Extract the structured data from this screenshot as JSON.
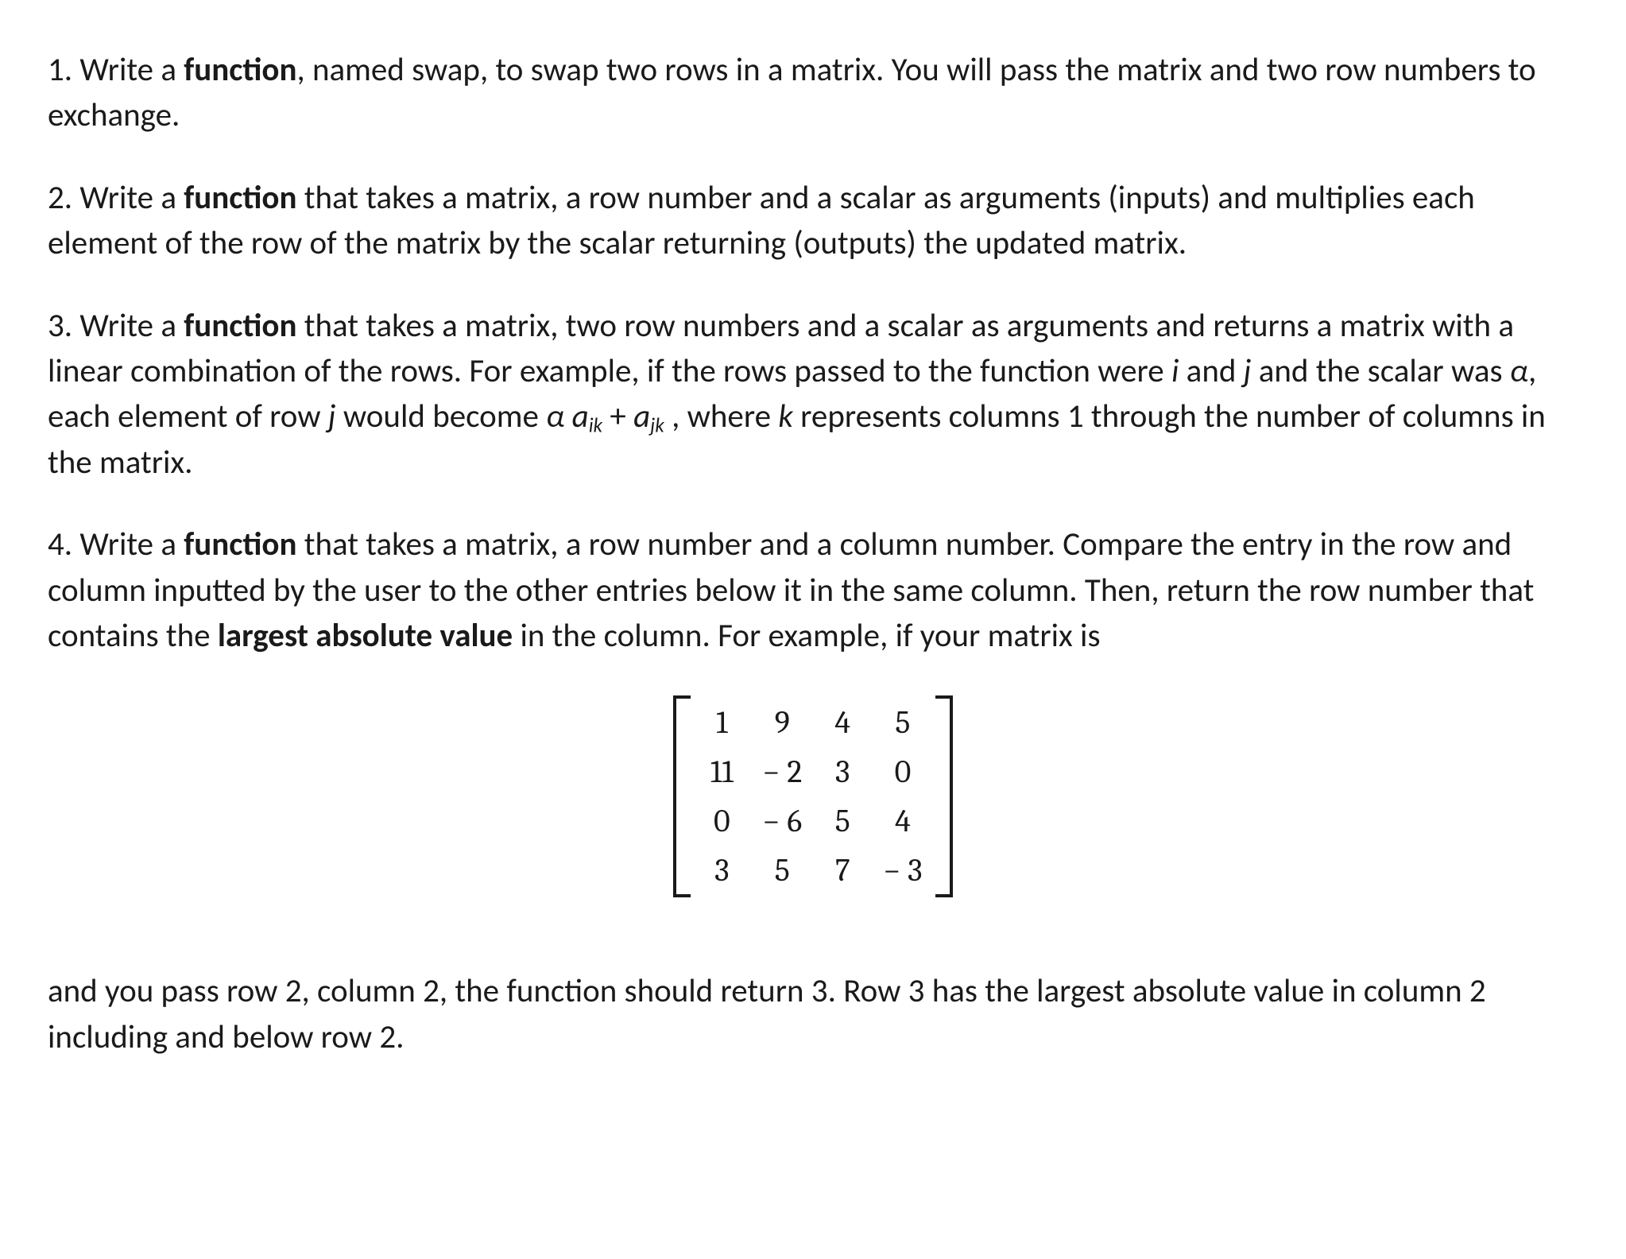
{
  "problems": {
    "p1": {
      "num": "1. ",
      "pre": "Write a ",
      "bold": "function",
      "post": ", named swap, to swap two rows in a matrix. You will pass the matrix and two row numbers to exchange."
    },
    "p2": {
      "num": "2. ",
      "pre": "Write a ",
      "bold": "function",
      "post": " that takes a matrix, a row number and a scalar as arguments (inputs) and multiplies each element of the row of the matrix by the scalar returning (outputs) the updated matrix."
    },
    "p3": {
      "num": "3. ",
      "pre": "Write a ",
      "bold": "function",
      "post1": " that takes a matrix, two row numbers and a scalar as arguments and returns a matrix with a linear combination of the rows. For example, if the rows passed to the function were ",
      "ital_i": "i",
      "and": " and ",
      "ital_j": "j",
      "post2": " and the scalar was ",
      "alpha": "α",
      "post3": ", each element of row ",
      "ital_j2": "j",
      "post4": " would become ",
      "alpha2": "α",
      "space": " ",
      "a1": "a",
      "sub1": "ik",
      "plus": " + ",
      "a2": "a",
      "sub2": "jk",
      "comma": " ,",
      "post5": " where ",
      "ital_k": "k",
      "post6": " represents columns 1 through the number of columns in the matrix."
    },
    "p4": {
      "num": "4. ",
      "pre": "Write a ",
      "bold": "function",
      "post1": " that takes a matrix, a row number and a column number. Compare the entry in the row and column inputted by the user to the other entries below it in the same column. Then, return the row number that contains the ",
      "bold2": "largest absolute value",
      "post2": " in the column. For example, if your matrix is"
    },
    "tail": "and you pass row 2, column 2, the function should return 3. Row 3 has the largest absolute value in column 2 including and below row 2."
  },
  "matrix": {
    "r1c1": "1",
    "r1c2": "9",
    "r1c3": "4",
    "r1c4": "5",
    "r2c1": "11",
    "r2c2": "− 2",
    "r2c3": "3",
    "r2c4": "0",
    "r3c1": "0",
    "r3c2": "− 6",
    "r3c3": "5",
    "r3c4": "4",
    "r4c1": "3",
    "r4c2": "5",
    "r4c3": "7",
    "r4c4": "− 3"
  }
}
